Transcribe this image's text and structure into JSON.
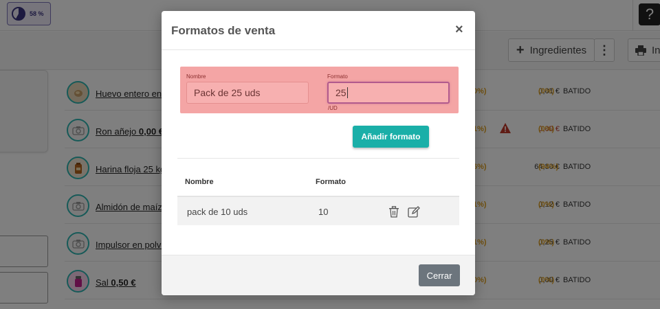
{
  "topbar": {
    "progress_label": "58 %",
    "progress_value": 0.58,
    "help_label": "?"
  },
  "toolbar": {
    "ingredientes_label": "Ingredientes",
    "more_label": "⋮",
    "print_label": "In"
  },
  "rows": [
    {
      "name_prefix": "Huevo entero en",
      "name_bold": "",
      "pct_left": "0%)",
      "price": "0,01 €",
      "pct": "(0%)",
      "tag": "BATIDO",
      "thumb": "egg-icon"
    },
    {
      "name_prefix": "Ron añejo ",
      "name_bold": "0,00 €",
      "pct_left": "1%)",
      "price": "0,00 €",
      "pct": "(0%)",
      "tag": "BATIDO",
      "thumb": "camera-icon",
      "warn": true
    },
    {
      "name_prefix": "Harina floja 25 kg",
      "name_bold": "",
      "pct_left": "6%)",
      "price": "64,80 €",
      "pct": "(94%)",
      "tag": "BATIDO",
      "thumb": "flour-icon"
    },
    {
      "name_prefix": "Almidón de maíz",
      "name_bold": "",
      "pct_left": "1%)",
      "price": "0,12 €",
      "pct": "(0%)",
      "tag": "BATIDO",
      "thumb": "camera-icon"
    },
    {
      "name_prefix": "Impulsor en polvo",
      "name_bold": "",
      "pct_left": "1%)",
      "price": "0,25 €",
      "pct": "(0%)",
      "tag": "BATIDO",
      "thumb": "camera-icon"
    },
    {
      "name_prefix": "Sal ",
      "name_bold": "0,50 €",
      "pct_left": "0%)",
      "price": "0,00 €",
      "pct": "(0%)",
      "tag": "BATIDO",
      "thumb": "salt-icon"
    }
  ],
  "modal": {
    "title": "Formatos de venta",
    "close_symbol": "×",
    "form": {
      "nombre_label": "Nombre",
      "nombre_value": "Pack de 25 uds",
      "formato_label": "Formato",
      "formato_value": "25",
      "unit": "/UD"
    },
    "add_button": "Añadir formato",
    "table": {
      "headers": [
        "Nombre",
        "Formato"
      ],
      "rows": [
        {
          "nombre": "pack de 10 uds",
          "formato": "10"
        }
      ]
    },
    "close_button": "Cerrar"
  }
}
